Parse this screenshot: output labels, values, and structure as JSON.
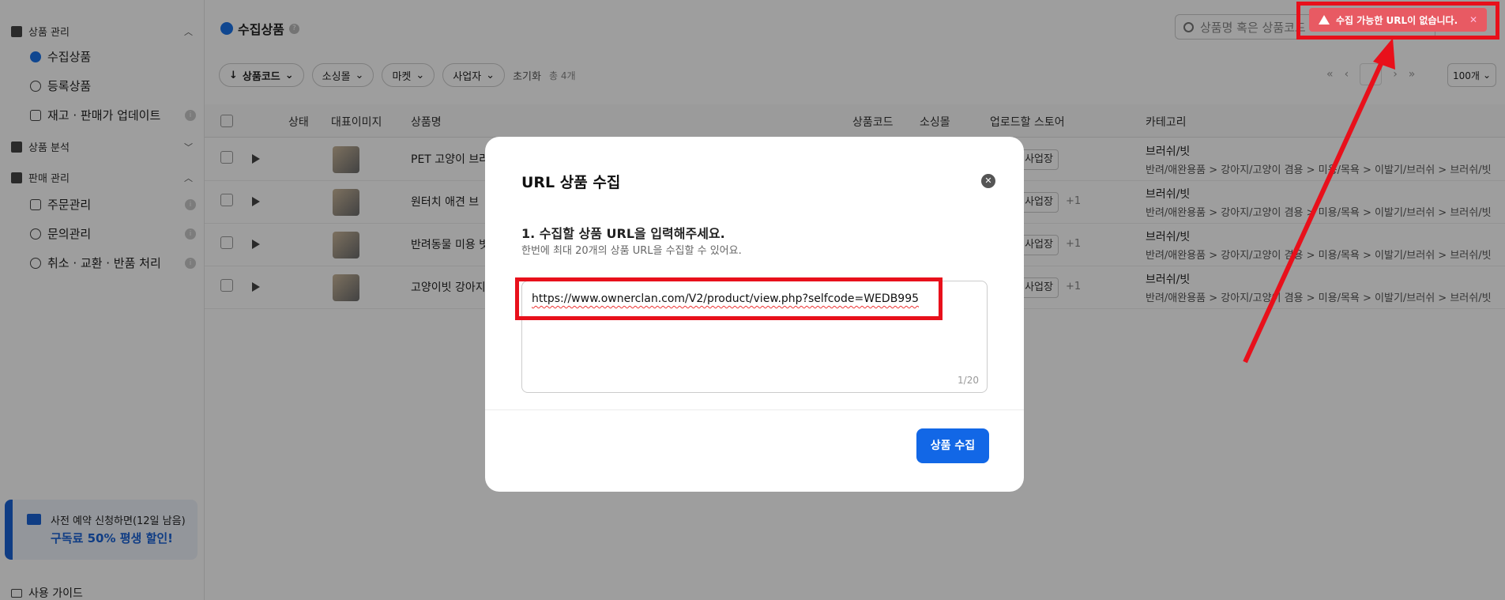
{
  "sidebar": {
    "sections": [
      {
        "label": "상품 관리",
        "chevron": "up"
      },
      {
        "label": "상품 분석",
        "chevron": "down"
      },
      {
        "label": "판매 관리",
        "chevron": "up"
      }
    ],
    "items": [
      {
        "label": "수집상품"
      },
      {
        "label": "등록상품"
      },
      {
        "label": "재고 · 판매가 업데이트"
      },
      {
        "label": "주문관리"
      },
      {
        "label": "문의관리"
      },
      {
        "label": "취소 · 교환 · 반품 처리"
      }
    ],
    "promo": {
      "line1": "사전 예약 신청하면(12일 남음)",
      "line2": "구독료 50% 평생 할인!"
    },
    "guide": "사용 가이드"
  },
  "header": {
    "title": "수집상품",
    "search_placeholder": "상품명 혹은 상품코드"
  },
  "filters": {
    "sort": "상품코드",
    "mall": "소싱몰",
    "market": "마켓",
    "seller": "사업자",
    "reset": "초기화",
    "count": "총 4개",
    "per_page": "100개"
  },
  "table": {
    "headers": [
      "상태",
      "대표이미지",
      "상품명",
      "상품코드",
      "소싱몰",
      "업로드할 스토어",
      "카테고리"
    ],
    "rows": [
      {
        "name": "PET 고양이 브러",
        "store": "본 사업장",
        "plus": "",
        "cat1": "브러쉬/빗",
        "cat2": "반려/애완용품 > 강아지/고양이 겸용 > 미용/목욕 > 이발기/브러쉬 > 브러쉬/빗"
      },
      {
        "name": "원터치 애견 브",
        "store": "본 사업장",
        "plus": "+1",
        "cat1": "브러쉬/빗",
        "cat2": "반려/애완용품 > 강아지/고양이 겸용 > 미용/목욕 > 이발기/브러쉬 > 브러쉬/빗"
      },
      {
        "name": "반려동물 미용 빗",
        "store": "본 사업장",
        "plus": "+1",
        "cat1": "브러쉬/빗",
        "cat2": "반려/애완용품 > 강아지/고양이 겸용 > 미용/목욕 > 이발기/브러쉬 > 브러쉬/빗"
      },
      {
        "name": "고양이빗 강아지",
        "store": "본 사업장",
        "plus": "+1",
        "cat1": "브러쉬/빗",
        "cat2": "반려/애완용품 > 강아지/고양이 겸용 > 미용/목욕 > 이발기/브러쉬 > 브러쉬/빗"
      }
    ]
  },
  "modal": {
    "title": "URL 상품 수집",
    "question": "1. 수집할 상품 URL을 입력해주세요.",
    "sub": "한번에 최대 20개의 상품 URL을 수집할 수 있어요.",
    "url_value": "https://www.ownerclan.com/V2/product/view.php?selfcode=WEDB995",
    "counter": "1/20",
    "submit": "상품 수집"
  },
  "toast": {
    "message": "수집 가능한 URL이 없습니다.",
    "close": "✕"
  },
  "colors": {
    "accent": "#1267e6",
    "annotation": "#e8101b",
    "toast_bg": "#e85a63"
  }
}
